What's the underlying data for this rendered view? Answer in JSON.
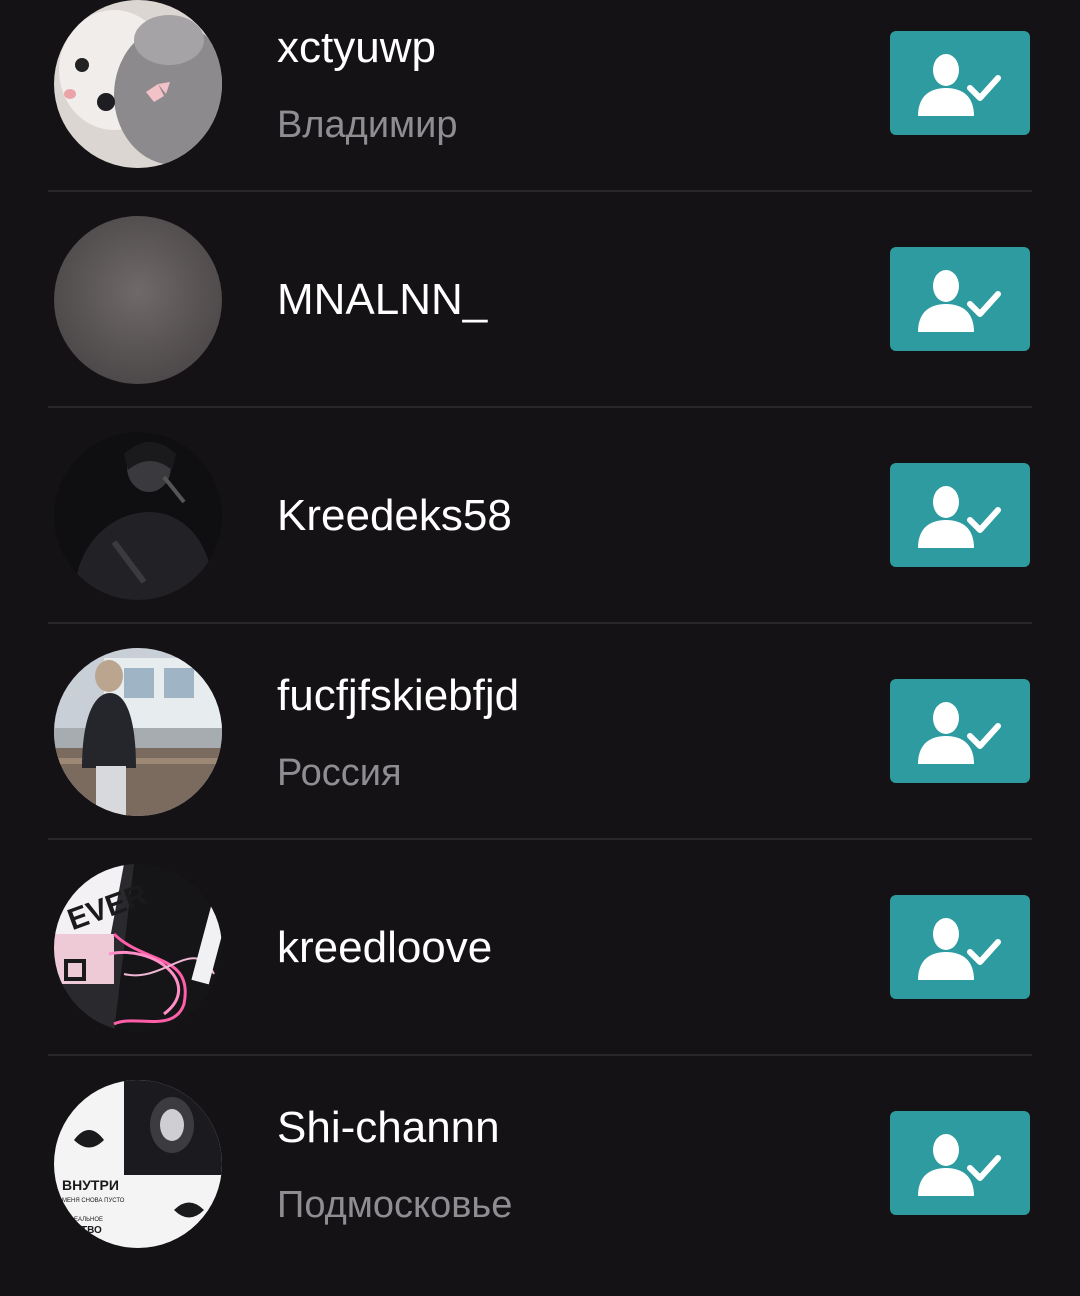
{
  "colors": {
    "background": "#141215",
    "divider": "#2a272c",
    "accent": "#2d9b9f",
    "name_text": "#ffffff",
    "secondary_text": "#8f8d92"
  },
  "friends": [
    {
      "username": "xctyuwp",
      "subtitle": "Владимир",
      "avatar": "kitten-photo",
      "action_icon": "user-check-icon"
    },
    {
      "username": "MNALNN_",
      "subtitle": "",
      "avatar": "blurred-photo",
      "action_icon": "user-check-icon"
    },
    {
      "username": "Kreedeks58",
      "subtitle": "",
      "avatar": "singer-photo",
      "action_icon": "user-check-icon"
    },
    {
      "username": "fucfjfskiebfjd",
      "subtitle": "Россия",
      "avatar": "window-girl-photo",
      "action_icon": "user-check-icon"
    },
    {
      "username": "kreedloove",
      "subtitle": "",
      "avatar": "pink-stickers-photo",
      "action_icon": "user-check-icon"
    },
    {
      "username": "Shi-channn",
      "subtitle": "Подмосковье",
      "avatar": "anime-poster-photo",
      "action_icon": "user-check-icon"
    }
  ],
  "avatar_texts": {
    "poster_main": "ВНУТРИ",
    "poster_line2": "МЕНЯ СНОВА ПУСТО",
    "poster_line3": "ЕАЛЬНОЕ",
    "poster_line4": "СТВО",
    "sticker_text": "EVER"
  }
}
